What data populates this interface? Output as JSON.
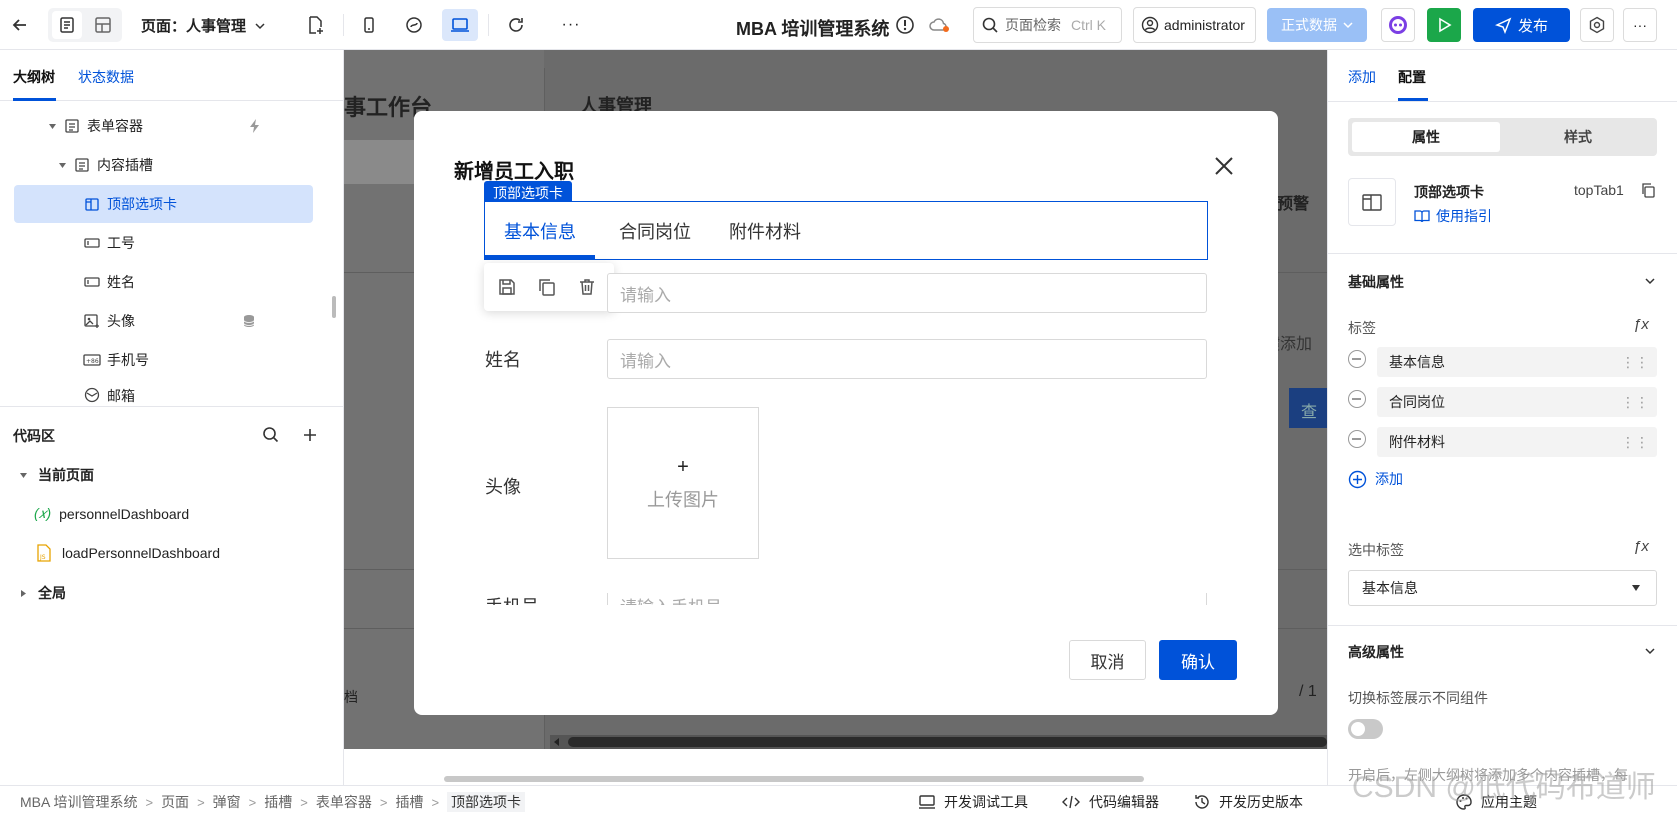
{
  "topbar": {
    "page_label": "页面：人事管理",
    "app_title": "MBA 培训管理系统",
    "search_placeholder": "页面检索",
    "search_shortcut": "Ctrl K",
    "user": "administrator",
    "env": "正式数据",
    "publish": "发布",
    "more": "···"
  },
  "left": {
    "tab_outline": "大纲树",
    "tab_state": "状态数据",
    "tree": [
      "表单容器",
      "内容插槽",
      "顶部选项卡",
      "工号",
      "姓名",
      "头像",
      "手机号",
      "邮箱"
    ],
    "code_title": "代码区",
    "current_page": "当前页面",
    "items": [
      "personnelDashboard",
      "loadPersonnelDashboard"
    ],
    "global": "全局"
  },
  "canvas": {
    "bg_title": "事工作台",
    "bg_header": "人事管理",
    "bg_right1": "预警",
    "bg_right2": "键添加",
    "bg_right3": "查",
    "bg_left": "档",
    "bg_page": "/ 1"
  },
  "modal": {
    "title": "新增员工入职",
    "component_tag": "顶部选项卡",
    "tabs": [
      "基本信息",
      "合同岗位",
      "附件材料"
    ],
    "name_label": "姓名",
    "avatar_label": "头像",
    "phone_label": "手机号",
    "placeholder": "请输入",
    "phone_placeholder": "请输入手机号",
    "upload_plus": "+",
    "upload_text": "上传图片",
    "cancel": "取消",
    "confirm": "确认"
  },
  "right": {
    "tab_add": "添加",
    "tab_config": "配置",
    "seg_prop": "属性",
    "seg_style": "样式",
    "comp_name": "顶部选项卡",
    "comp_id": "topTab1",
    "guide": "使用指引",
    "basic_section": "基础属性",
    "tag_label": "标签",
    "fx": "ƒx",
    "tags": [
      "基本信息",
      "合同岗位",
      "附件材料"
    ],
    "add": "添加",
    "selected_label": "选中标签",
    "selected_value": "基本信息",
    "advanced_section": "高级属性",
    "switch_label": "切换标签展示不同组件",
    "note": "开启后，左侧大纲树将添加多个内容插槽，每"
  },
  "bottom": {
    "crumbs": [
      "MBA 培训管理系统",
      "页面",
      "弹窗",
      "插槽",
      "表单容器",
      "插槽",
      "顶部选项卡"
    ],
    "dev_tools": "开发调试工具",
    "code_editor": "代码编辑器",
    "history": "开发历史版本",
    "theme": "应用主题",
    "watermark": "CSDN @低代码布道师"
  },
  "colors": {
    "primary": "#0052d9",
    "green": "#1ba74a",
    "selected_bg": "#d4e3fc"
  }
}
